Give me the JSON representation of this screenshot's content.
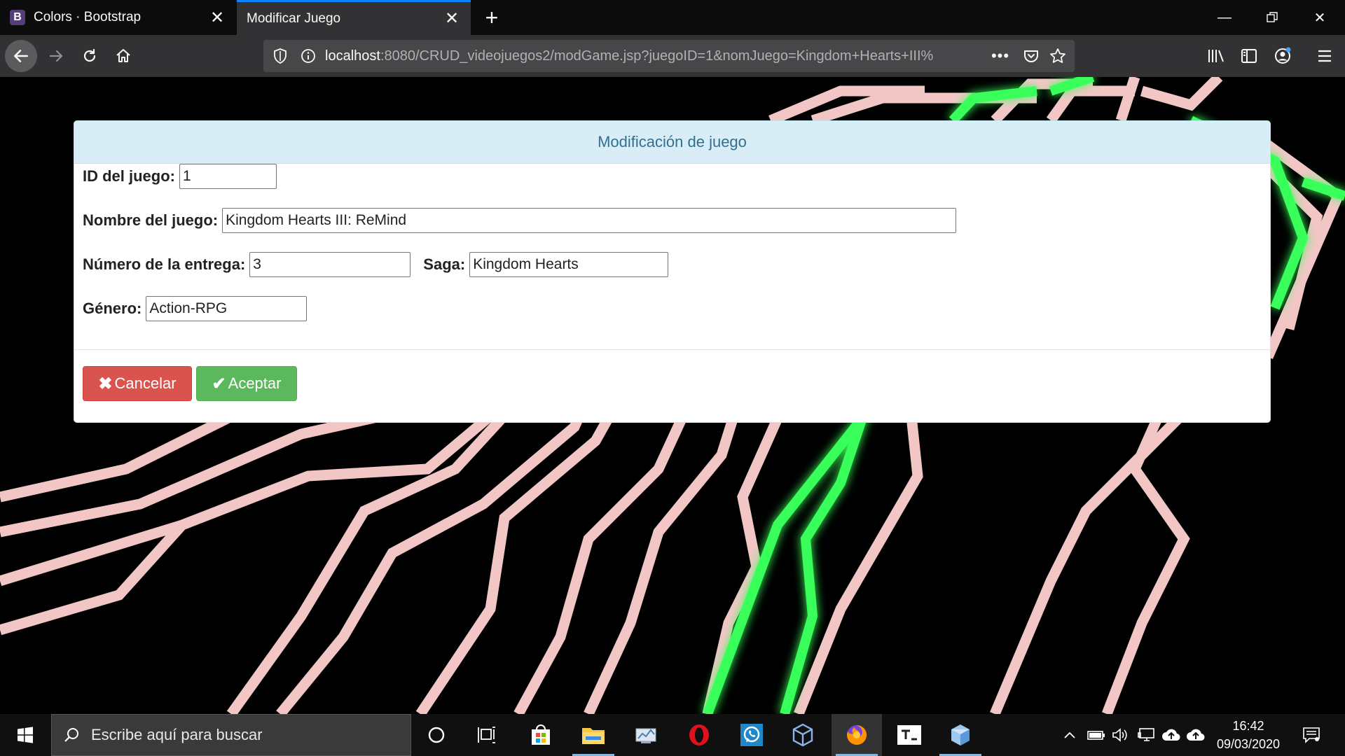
{
  "browser": {
    "tabs": [
      {
        "favicon": "B",
        "title": "Colors · Bootstrap",
        "active": false
      },
      {
        "title": "Modificar Juego",
        "active": true
      }
    ],
    "url_host": "localhost",
    "url_rest": ":8080/CRUD_videojuegos2/modGame.jsp?juegoID=1&nomJuego=Kingdom+Hearts+III%"
  },
  "form": {
    "heading": "Modificación de juego",
    "id_label": "ID del juego:",
    "id_value": "1",
    "name_label": "Nombre del juego:",
    "name_value": "Kingdom Hearts III: ReMind",
    "number_label": "Número de la entrega:",
    "number_value": "3",
    "saga_label": "Saga:",
    "saga_value": "Kingdom Hearts",
    "genre_label": "Género:",
    "genre_value": "Action-RPG",
    "cancel_label": "Cancelar",
    "accept_label": "Aceptar"
  },
  "taskbar": {
    "search_placeholder": "Escribe aquí para buscar",
    "time": "16:42",
    "date": "09/03/2020"
  },
  "colors": {
    "panel_heading_bg": "#d9edf7",
    "panel_heading_text": "#31708f",
    "danger": "#d9534f",
    "success": "#5cb85c",
    "neon_green": "#39ff5a",
    "circuit_pink": "#f3c6c6"
  }
}
